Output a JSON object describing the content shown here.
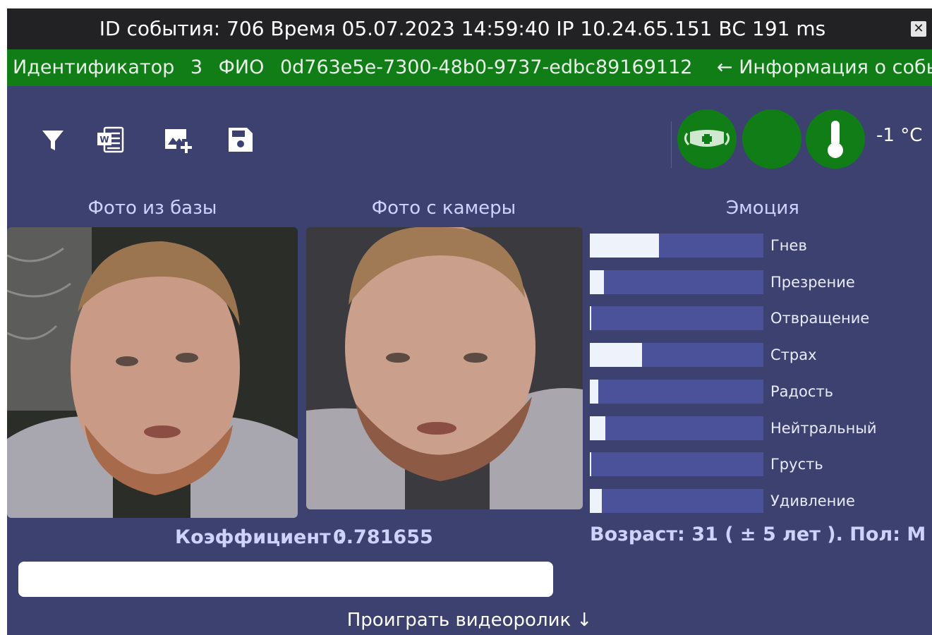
{
  "window": {
    "title": "ID события: 706  Время 05.07.2023 14:59:40 IP 10.24.65.151 ВС 191 ms",
    "close_label": "✕"
  },
  "infobar": {
    "identifier_label": "Идентификатор",
    "identifier_value": "3",
    "fio_label": "ФИО",
    "fio_value": "0d763e5e-7300-48b0-9737-edbc89169112",
    "event_info_link": "← Информация о событии"
  },
  "toolbar": {
    "icons": [
      "filter-icon",
      "word-document-icon",
      "add-image-icon",
      "save-icon"
    ]
  },
  "status": {
    "icons": [
      "medical-mask-icon",
      "status-indicator",
      "thermometer-icon"
    ],
    "temperature": "-1 °C",
    "color": "#117d17"
  },
  "photos": {
    "db_label": "Фото из базы",
    "camera_label": "Фото с камеры"
  },
  "emotion": {
    "title": "Эмоция",
    "items": [
      {
        "label": "Гнев",
        "value": 0.4
      },
      {
        "label": "Презрение",
        "value": 0.08
      },
      {
        "label": "Отвращение",
        "value": 0.01
      },
      {
        "label": "Страх",
        "value": 0.3
      },
      {
        "label": "Радость",
        "value": 0.05
      },
      {
        "label": "Нейтральный",
        "value": 0.09
      },
      {
        "label": "Грусть",
        "value": 0.01
      },
      {
        "label": "Удивление",
        "value": 0.07
      }
    ]
  },
  "match": {
    "coef_label": "Коэффициент :",
    "coef_value": "0.781655"
  },
  "person": {
    "age_gender": "Возраст: 31 ( ± 5 лет ). Пол: М"
  },
  "video": {
    "play_label": "Проиграть видеоролик ↓"
  },
  "colors": {
    "background": "#3d4170",
    "titlebar": "#222225",
    "infobar": "#117d17",
    "bar_track": "#4b529a",
    "bar_fill": "#eef3fb"
  }
}
